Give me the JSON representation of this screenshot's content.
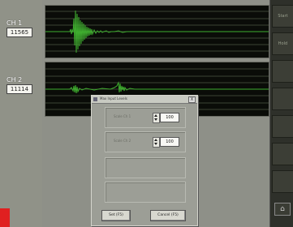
{
  "channels": [
    {
      "label": "CH 1",
      "value": "11565"
    },
    {
      "label": "CH 2",
      "value": "11114"
    }
  ],
  "right_rail": {
    "buttons": [
      "Start",
      "Hold",
      "",
      "",
      "",
      "",
      "",
      ""
    ],
    "home_icon": "home-icon"
  },
  "dialog": {
    "title": "Max Input Levels",
    "close": "X",
    "fields": [
      {
        "label": "Scale Ch 1",
        "value": "100"
      },
      {
        "label": "Scale Ch 2",
        "value": "100"
      }
    ],
    "ok_label": "Set (F5)",
    "cancel_label": "Cancel (F5)"
  },
  "colors": {
    "trace": "#3fae2f",
    "plot_bg": "#0a0c08",
    "grid": "#6f7a5e"
  }
}
